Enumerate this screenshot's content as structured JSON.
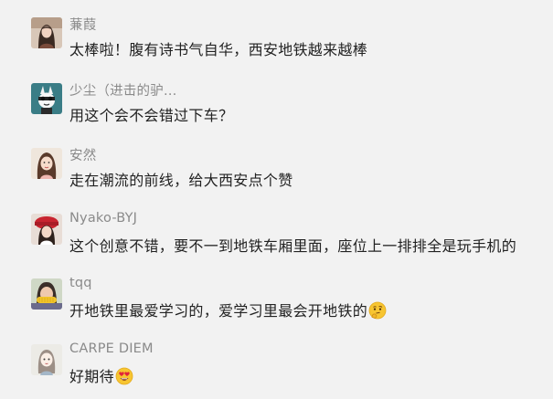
{
  "comments": [
    {
      "nickname": "蒹葭",
      "text": "太棒啦！腹有诗书气自华，西安地铁越来越棒",
      "avatar_icon": "girl-portrait-avatar"
    },
    {
      "nickname": "少尘（进击的驴…",
      "text": "用这个会不会错过下车？",
      "avatar_icon": "cartoon-character-avatar"
    },
    {
      "nickname": "安然",
      "text": "走在潮流的前线，给大西安点个赞",
      "avatar_icon": "girl-selfie-avatar"
    },
    {
      "nickname": "Nyako-BYJ",
      "text": "这个创意不错，要不一到地铁车厢里面，座位上一排排全是玩手机的",
      "avatar_icon": "girl-red-hat-avatar"
    },
    {
      "nickname": "tqq",
      "text": "开地铁里最爱学习的，爱学习里最会开地铁的",
      "avatar_icon": "person-eating-corn-avatar",
      "emoji": "thinking-face-emoji"
    },
    {
      "nickname": "CARPE DIEM",
      "text": "好期待",
      "avatar_icon": "illustrated-girl-avatar",
      "emoji": "heart-eyes-emoji"
    }
  ],
  "colors": {
    "background": "#f2f2f2",
    "nickname": "#8a8a8a",
    "text": "#222222"
  }
}
